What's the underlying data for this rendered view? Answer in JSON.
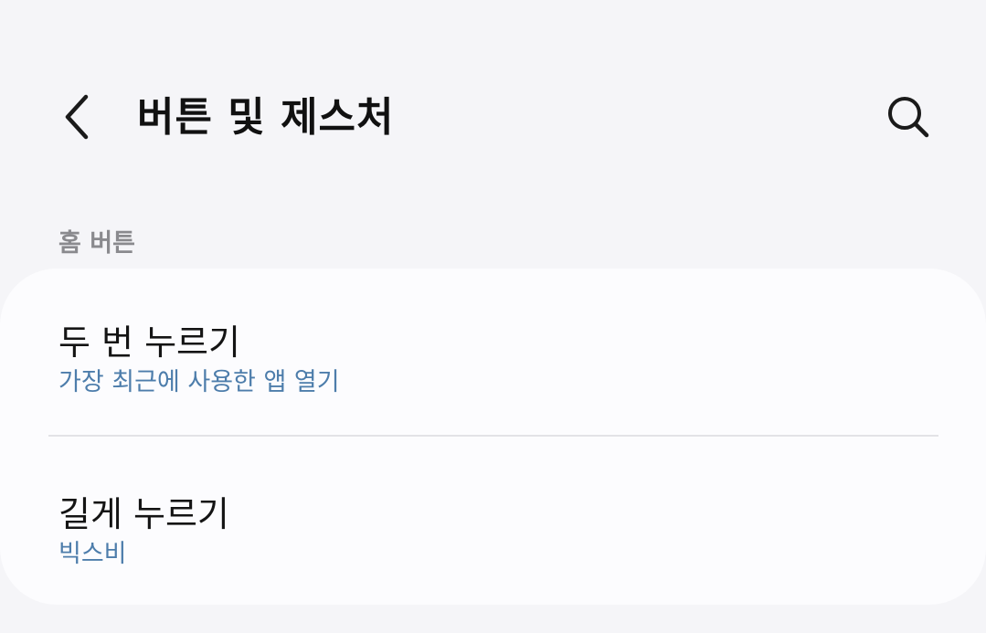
{
  "header": {
    "title": "버튼 및 제스처",
    "back_icon": "chevron-left-icon",
    "search_icon": "search-icon"
  },
  "section": {
    "title": "홈 버튼"
  },
  "items": [
    {
      "title": "두 번 누르기",
      "subtitle": "가장 최근에 사용한 앱 열기"
    },
    {
      "title": "길게 누르기",
      "subtitle": "빅스비"
    }
  ],
  "colors": {
    "background": "#f5f5f8",
    "card": "#fcfcfe",
    "subtitle_accent": "#4d7dab",
    "section_header": "#8a8a8e"
  }
}
